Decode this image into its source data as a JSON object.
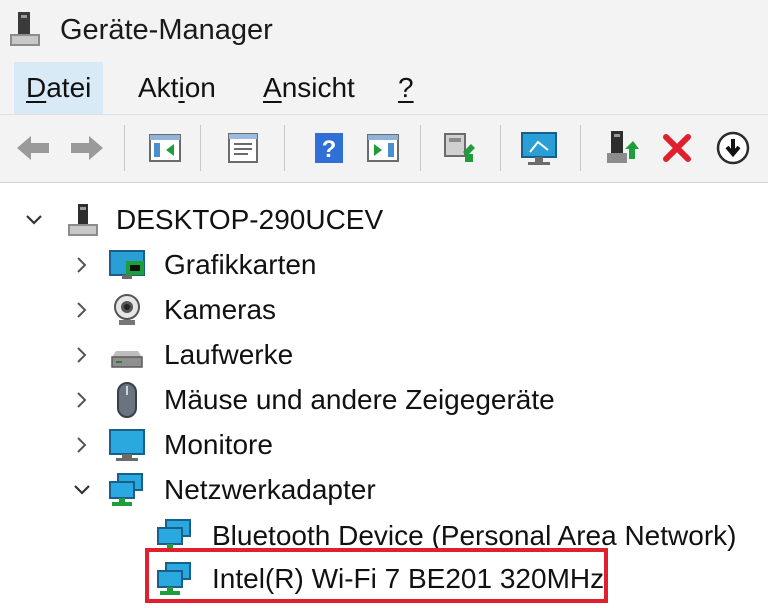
{
  "window": {
    "title": "Geräte-Manager"
  },
  "menu": [
    {
      "pre": "",
      "u": "D",
      "post": "atei",
      "active": true
    },
    {
      "pre": "Akt",
      "u": "i",
      "post": "on",
      "active": false
    },
    {
      "pre": "",
      "u": "A",
      "post": "nsicht",
      "active": false
    },
    {
      "pre": "",
      "u": "?",
      "post": "",
      "active": false
    }
  ],
  "toolbar": {
    "icons": [
      "back-arrow-icon",
      "forward-arrow-icon",
      "show-hide-console-tree-icon",
      "properties-icon",
      "help-icon",
      "show-action-pane-icon",
      "scan-hardware-icon",
      "monitor-icon",
      "update-driver-icon",
      "uninstall-icon",
      "disable-device-icon"
    ]
  },
  "tree": {
    "root": "DESKTOP-290UCEV",
    "categories": [
      {
        "label": "Grafikkarten",
        "icon": "display-adapter-icon",
        "expanded": false
      },
      {
        "label": "Kameras",
        "icon": "camera-icon",
        "expanded": false
      },
      {
        "label": "Laufwerke",
        "icon": "disk-drive-icon",
        "expanded": false
      },
      {
        "label": "Mäuse und andere Zeigegeräte",
        "icon": "mouse-icon",
        "expanded": false
      },
      {
        "label": "Monitore",
        "icon": "monitor-icon",
        "expanded": false
      },
      {
        "label": "Netzwerkadapter",
        "icon": "network-adapter-icon",
        "expanded": true
      }
    ],
    "network_children": [
      {
        "label": "Bluetooth Device (Personal Area Network)"
      },
      {
        "label": "Intel(R) Wi-Fi 7 BE201 320MHz"
      }
    ]
  },
  "colors": {
    "highlight_border": "#e0202c",
    "menu_active": "#d9eaf7"
  }
}
